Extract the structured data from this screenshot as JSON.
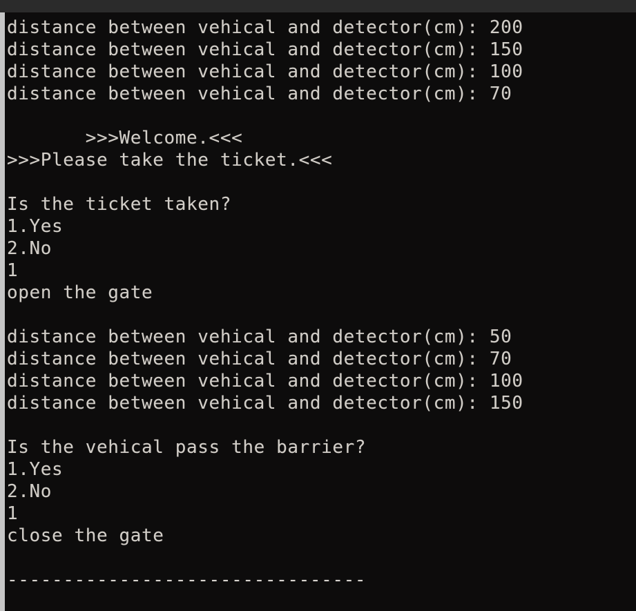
{
  "window": {
    "title_bar_color": "#2b2b2b",
    "background_color": "#0d0c0c",
    "text_color": "#d2cec8",
    "scrollbar_color": "#c6c6c6"
  },
  "console": {
    "prompt_distance_label": "distance between vehical and detector(cm): ",
    "lines": [
      {
        "id": "dist-1",
        "text": "distance between vehical and detector(cm): 200"
      },
      {
        "id": "dist-2",
        "text": "distance between vehical and detector(cm): 150"
      },
      {
        "id": "dist-3",
        "text": "distance between vehical and detector(cm): 100"
      },
      {
        "id": "dist-4",
        "text": "distance between vehical and detector(cm): 70"
      },
      {
        "id": "blank-1",
        "text": ""
      },
      {
        "id": "welcome",
        "text": "       >>>Welcome.<<<"
      },
      {
        "id": "take-ticket",
        "text": ">>>Please take the ticket.<<<"
      },
      {
        "id": "blank-2",
        "text": ""
      },
      {
        "id": "question-ticket",
        "text": "Is the ticket taken?"
      },
      {
        "id": "ticket-option-1",
        "text": "1.Yes"
      },
      {
        "id": "ticket-option-2",
        "text": "2.No"
      },
      {
        "id": "ticket-answer",
        "text": "1"
      },
      {
        "id": "open-gate",
        "text": "open the gate"
      },
      {
        "id": "blank-3",
        "text": ""
      },
      {
        "id": "dist-5",
        "text": "distance between vehical and detector(cm): 50"
      },
      {
        "id": "dist-6",
        "text": "distance between vehical and detector(cm): 70"
      },
      {
        "id": "dist-7",
        "text": "distance between vehical and detector(cm): 100"
      },
      {
        "id": "dist-8",
        "text": "distance between vehical and detector(cm): 150"
      },
      {
        "id": "blank-4",
        "text": ""
      },
      {
        "id": "question-barrier",
        "text": "Is the vehical pass the barrier?"
      },
      {
        "id": "barrier-option-1",
        "text": "1.Yes"
      },
      {
        "id": "barrier-option-2",
        "text": "2.No"
      },
      {
        "id": "barrier-answer",
        "text": "1"
      },
      {
        "id": "close-gate",
        "text": "close the gate"
      },
      {
        "id": "blank-5",
        "text": ""
      },
      {
        "id": "separator",
        "text": "--------------------------------"
      }
    ],
    "readings_first_pass": [
      200,
      150,
      100,
      70
    ],
    "readings_second_pass": [
      50,
      70,
      100,
      150
    ],
    "unit": "cm",
    "messages": {
      "welcome": ">>>Welcome.<<<",
      "take_ticket": ">>>Please take the ticket.<<<",
      "open_gate": "open the gate",
      "close_gate": "close the gate"
    },
    "prompts": [
      {
        "question": "Is the ticket taken?",
        "options": [
          "1.Yes",
          "2.No"
        ],
        "answer": "1"
      },
      {
        "question": "Is the vehical pass the barrier?",
        "options": [
          "1.Yes",
          "2.No"
        ],
        "answer": "1"
      }
    ]
  }
}
